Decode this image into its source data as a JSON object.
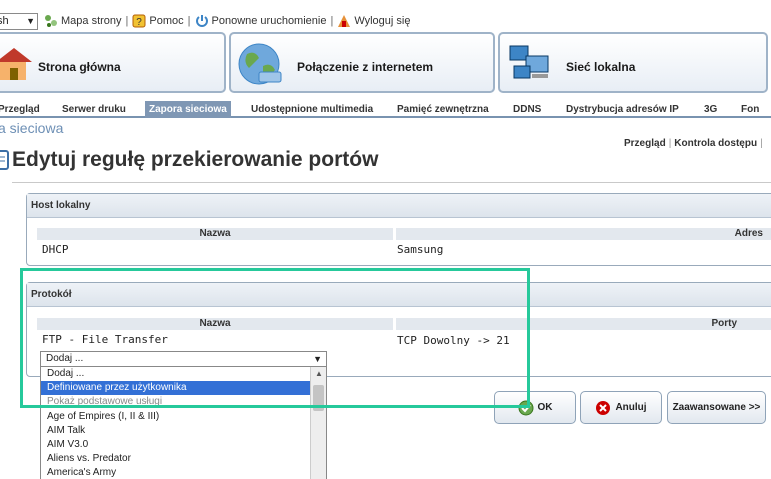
{
  "topbar": {
    "language_value": "sh",
    "links": [
      "Mapa strony",
      "Pomoc",
      "Ponowne uruchomienie",
      "Wyloguj się"
    ]
  },
  "main_nav": [
    "Strona główna",
    "Połączenie z internetem",
    "Sieć lokalna"
  ],
  "tabs": [
    "Przegląd",
    "Serwer druku",
    "Zapora sieciowa",
    "Udostępnione multimedia",
    "Pamięć zewnętrzna",
    "DDNS",
    "Dystrybucja adresów IP",
    "3G",
    "Fon"
  ],
  "section_crumb": "a sieciowa",
  "subnav": [
    "Przegląd",
    "Kontrola dostępu"
  ],
  "page_title": "Edytuj regułę przekierowanie portów",
  "host": {
    "title": "Host lokalny",
    "col_name": "Nazwa",
    "col_addr": "Adres",
    "row_name": "DHCP",
    "row_addr": "Samsung"
  },
  "protocol": {
    "title": "Protokół",
    "col_name": "Nazwa",
    "col_ports": "Porty",
    "row_name": "FTP - File Transfer",
    "row_ports": "TCP Dowolny -> 21",
    "select_value": "Dodaj ...",
    "options": [
      "Dodaj ...",
      "Definiowane przez użytkownika",
      "Pokaż podstawowe usługi",
      "Age of Empires (I, II & III)",
      "AIM Talk",
      "AIM V3.0",
      "Aliens vs. Predator",
      "America's Army"
    ]
  },
  "buttons": {
    "ok": "OK",
    "cancel": "Anuluj",
    "advanced": "Zaawansowane >>"
  },
  "colors": {
    "highlight": "#26c99b",
    "tab_active": "#7f97b4",
    "option_selected": "#3370d6"
  }
}
